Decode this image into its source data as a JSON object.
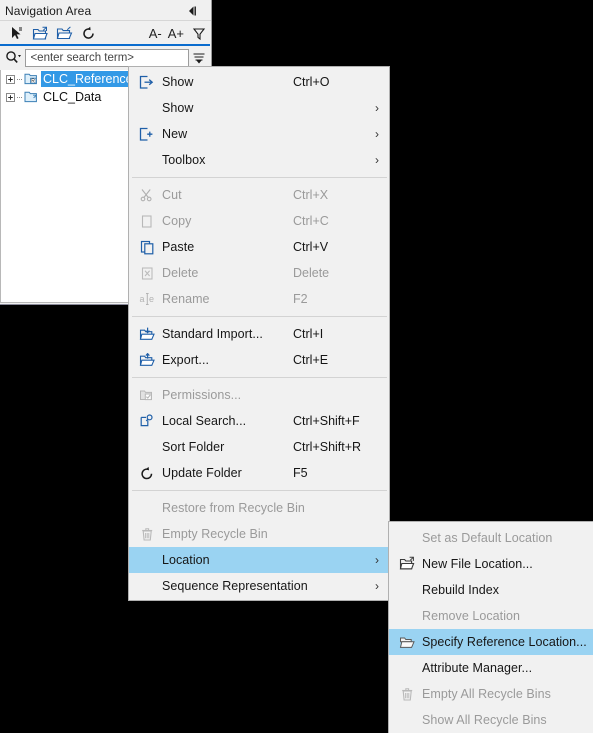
{
  "nav_panel": {
    "title": "Navigation Area",
    "collapse_icon": "collapse-left-icon",
    "toolbar": {
      "icons": [
        "cursor-arrow-icon",
        "add-folder-icon",
        "open-folder-icon",
        "refresh-icon"
      ],
      "font_decrease": "A-",
      "font_increase": "A+",
      "filter_icon": "filter-funnel-icon"
    },
    "search": {
      "icon": "search-magnifier-icon",
      "placeholder": "<enter search term>",
      "value": "",
      "options_icon": "search-options-icon"
    },
    "tree": {
      "items": [
        {
          "label": "CLC_Reference",
          "icon": "reference-folder-icon",
          "selected": true,
          "expander": "plus"
        },
        {
          "label": "CLC_Data",
          "icon": "data-folder-icon",
          "selected": false,
          "expander": "plus"
        }
      ]
    }
  },
  "context_menu": {
    "items": [
      {
        "kind": "item",
        "label": "Show",
        "accel": "Ctrl+O",
        "icon": "show-open-icon",
        "disabled": false,
        "submenu": false
      },
      {
        "kind": "item",
        "label": "Show",
        "accel": "",
        "icon": "",
        "disabled": false,
        "submenu": true
      },
      {
        "kind": "item",
        "label": "New",
        "accel": "",
        "icon": "new-plus-icon",
        "disabled": false,
        "submenu": true
      },
      {
        "kind": "item",
        "label": "Toolbox",
        "accel": "",
        "icon": "",
        "disabled": false,
        "submenu": true
      },
      {
        "kind": "separator"
      },
      {
        "kind": "item",
        "label": "Cut",
        "accel": "Ctrl+X",
        "icon": "scissors-icon",
        "disabled": true,
        "submenu": false
      },
      {
        "kind": "item",
        "label": "Copy",
        "accel": "Ctrl+C",
        "icon": "copy-icon",
        "disabled": true,
        "submenu": false
      },
      {
        "kind": "item",
        "label": "Paste",
        "accel": "Ctrl+V",
        "icon": "paste-icon",
        "disabled": false,
        "submenu": false
      },
      {
        "kind": "item",
        "label": "Delete",
        "accel": "Delete",
        "icon": "delete-icon",
        "disabled": true,
        "submenu": false
      },
      {
        "kind": "item",
        "label": "Rename",
        "accel": "F2",
        "icon": "rename-icon",
        "disabled": true,
        "submenu": false
      },
      {
        "kind": "separator"
      },
      {
        "kind": "item",
        "label": "Standard Import...",
        "accel": "Ctrl+I",
        "icon": "import-icon",
        "disabled": false,
        "submenu": false
      },
      {
        "kind": "item",
        "label": "Export...",
        "accel": "Ctrl+E",
        "icon": "export-icon",
        "disabled": false,
        "submenu": false
      },
      {
        "kind": "separator"
      },
      {
        "kind": "item",
        "label": "Permissions...",
        "accel": "",
        "icon": "permissions-icon",
        "disabled": true,
        "submenu": false
      },
      {
        "kind": "item",
        "label": "Local Search...",
        "accel": "Ctrl+Shift+F",
        "icon": "local-search-icon",
        "disabled": false,
        "submenu": false
      },
      {
        "kind": "item",
        "label": "Sort Folder",
        "accel": "Ctrl+Shift+R",
        "icon": "",
        "disabled": false,
        "submenu": false
      },
      {
        "kind": "item",
        "label": "Update Folder",
        "accel": "F5",
        "icon": "refresh-icon",
        "disabled": false,
        "submenu": false
      },
      {
        "kind": "separator"
      },
      {
        "kind": "item",
        "label": "Restore from Recycle Bin",
        "accel": "",
        "icon": "",
        "disabled": true,
        "submenu": false
      },
      {
        "kind": "item",
        "label": "Empty Recycle Bin",
        "accel": "",
        "icon": "trash-icon",
        "disabled": true,
        "submenu": false
      },
      {
        "kind": "item",
        "label": "Location",
        "accel": "",
        "icon": "",
        "disabled": false,
        "submenu": true,
        "highlighted": true
      },
      {
        "kind": "item",
        "label": "Sequence Representation",
        "accel": "",
        "icon": "",
        "disabled": false,
        "submenu": true
      }
    ]
  },
  "location_submenu": {
    "items": [
      {
        "kind": "item",
        "label": "Set as Default Location",
        "icon": "",
        "disabled": true
      },
      {
        "kind": "item",
        "label": "New File Location...",
        "icon": "new-file-location-icon",
        "disabled": false
      },
      {
        "kind": "item",
        "label": "Rebuild Index",
        "icon": "",
        "disabled": false
      },
      {
        "kind": "item",
        "label": "Remove Location",
        "icon": "",
        "disabled": true
      },
      {
        "kind": "item",
        "label": "Specify Reference Location...",
        "icon": "open-folder-icon",
        "disabled": false,
        "highlighted": true
      },
      {
        "kind": "item",
        "label": "Attribute Manager...",
        "icon": "",
        "disabled": false
      },
      {
        "kind": "item",
        "label": "Empty All Recycle Bins",
        "icon": "trash-icon",
        "disabled": true
      },
      {
        "kind": "item",
        "label": "Show All Recycle Bins",
        "icon": "",
        "disabled": true
      }
    ]
  },
  "colors": {
    "menu_bg": "#f1f1f1",
    "highlight": "#9ad3f2",
    "selection_blue": "#3399e6",
    "accent_underline": "#0a6cce",
    "icon_blue": "#1f5fa8",
    "disabled_text": "#9a9a9a"
  }
}
